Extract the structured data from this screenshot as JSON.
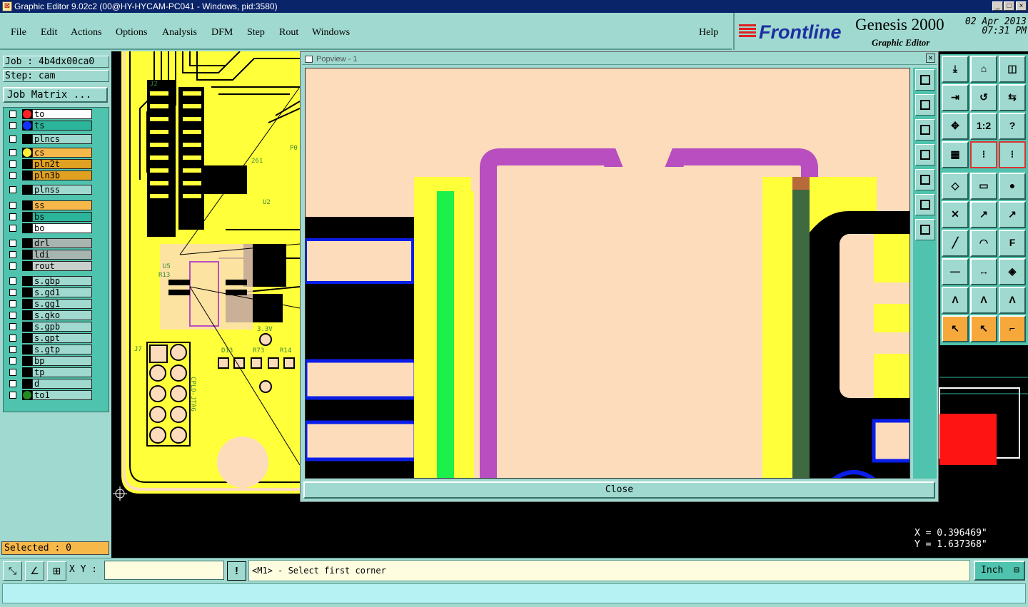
{
  "window": {
    "title": "Graphic Editor 9.02c2 (00@HY-HYCAM-PC041 - Windows, pid:3580)"
  },
  "menu": {
    "items": [
      "File",
      "Edit",
      "Actions",
      "Options",
      "Analysis",
      "DFM",
      "Step",
      "Rout",
      "Windows"
    ],
    "help": "Help"
  },
  "brand": {
    "logo": "Frontline",
    "product": "Genesis 2000",
    "subtitle": "Graphic Editor",
    "date": "02 Apr 2013",
    "time": "07:31 PM"
  },
  "job": {
    "job_label": "Job : 4b4dx00ca0",
    "step_label": "Step: cam",
    "matrix_button": "Job Matrix ..."
  },
  "layers": [
    {
      "name": "to",
      "bg": "#ffffff",
      "dot": "#ff2222"
    },
    {
      "name": "ts",
      "bg": "#2bb59b",
      "dot": "#1133ff"
    },
    {
      "name": "plncs",
      "bg": "#9fd9cf",
      "dot": ""
    },
    {
      "name": "cs",
      "bg": "#f7b84a",
      "dot": "#ffee33"
    },
    {
      "name": "pln2t",
      "bg": "#e0a020",
      "dot": ""
    },
    {
      "name": "pln3b",
      "bg": "#e0a020",
      "dot": ""
    },
    {
      "name": "plnss",
      "bg": "#9fd9cf",
      "dot": ""
    },
    {
      "name": "ss",
      "bg": "#f7b84a",
      "dot": ""
    },
    {
      "name": "bs",
      "bg": "#2bb59b",
      "dot": ""
    },
    {
      "name": "bo",
      "bg": "#ffffff",
      "dot": ""
    },
    {
      "name": "drl",
      "bg": "#a8b4b0",
      "dot": ""
    },
    {
      "name": "ldi",
      "bg": "#a8b4b0",
      "dot": ""
    },
    {
      "name": "rout",
      "bg": "#c8d0cc",
      "dot": ""
    },
    {
      "name": "s.gbp",
      "bg": "#9fd9cf",
      "dot": ""
    },
    {
      "name": "s.gd1",
      "bg": "#9fd9cf",
      "dot": ""
    },
    {
      "name": "s.gg1",
      "bg": "#9fd9cf",
      "dot": ""
    },
    {
      "name": "s.gko",
      "bg": "#9fd9cf",
      "dot": ""
    },
    {
      "name": "s.gpb",
      "bg": "#9fd9cf",
      "dot": ""
    },
    {
      "name": "s.gpt",
      "bg": "#9fd9cf",
      "dot": ""
    },
    {
      "name": "s.gtp",
      "bg": "#9fd9cf",
      "dot": ""
    },
    {
      "name": "bp",
      "bg": "#9fd9cf",
      "dot": ""
    },
    {
      "name": "tp",
      "bg": "#9fd9cf",
      "dot": ""
    },
    {
      "name": "d",
      "bg": "#9fd9cf",
      "dot": ""
    },
    {
      "name": "to1",
      "bg": "#9fd9cf",
      "dot": "#228b22"
    }
  ],
  "selected": "Selected : 0",
  "popview": {
    "title": "Popview - 1",
    "close_button": "Close"
  },
  "coords": {
    "x": "X = 0.396469\"",
    "y": "Y = 1.637368\""
  },
  "bottom": {
    "xy_label": "X Y :",
    "xy_value": "",
    "prompt": "<M1> - Select first corner",
    "unit": "Inch"
  },
  "pcb_labels": [
    "J2",
    "U2",
    "U5",
    "R13",
    "J7",
    "CPLD-JTAG",
    "D13",
    "R73",
    "R14",
    "3.3V",
    "261",
    "P0"
  ],
  "colors": {
    "board_yellow": "#ffff3a",
    "pad_peach": "#fddcbc",
    "trace_purple": "#b84ec0",
    "outline_blue": "#0a1ee8",
    "ui_teal": "#9fd9cf",
    "ui_dark_teal": "#4fc3ad"
  }
}
